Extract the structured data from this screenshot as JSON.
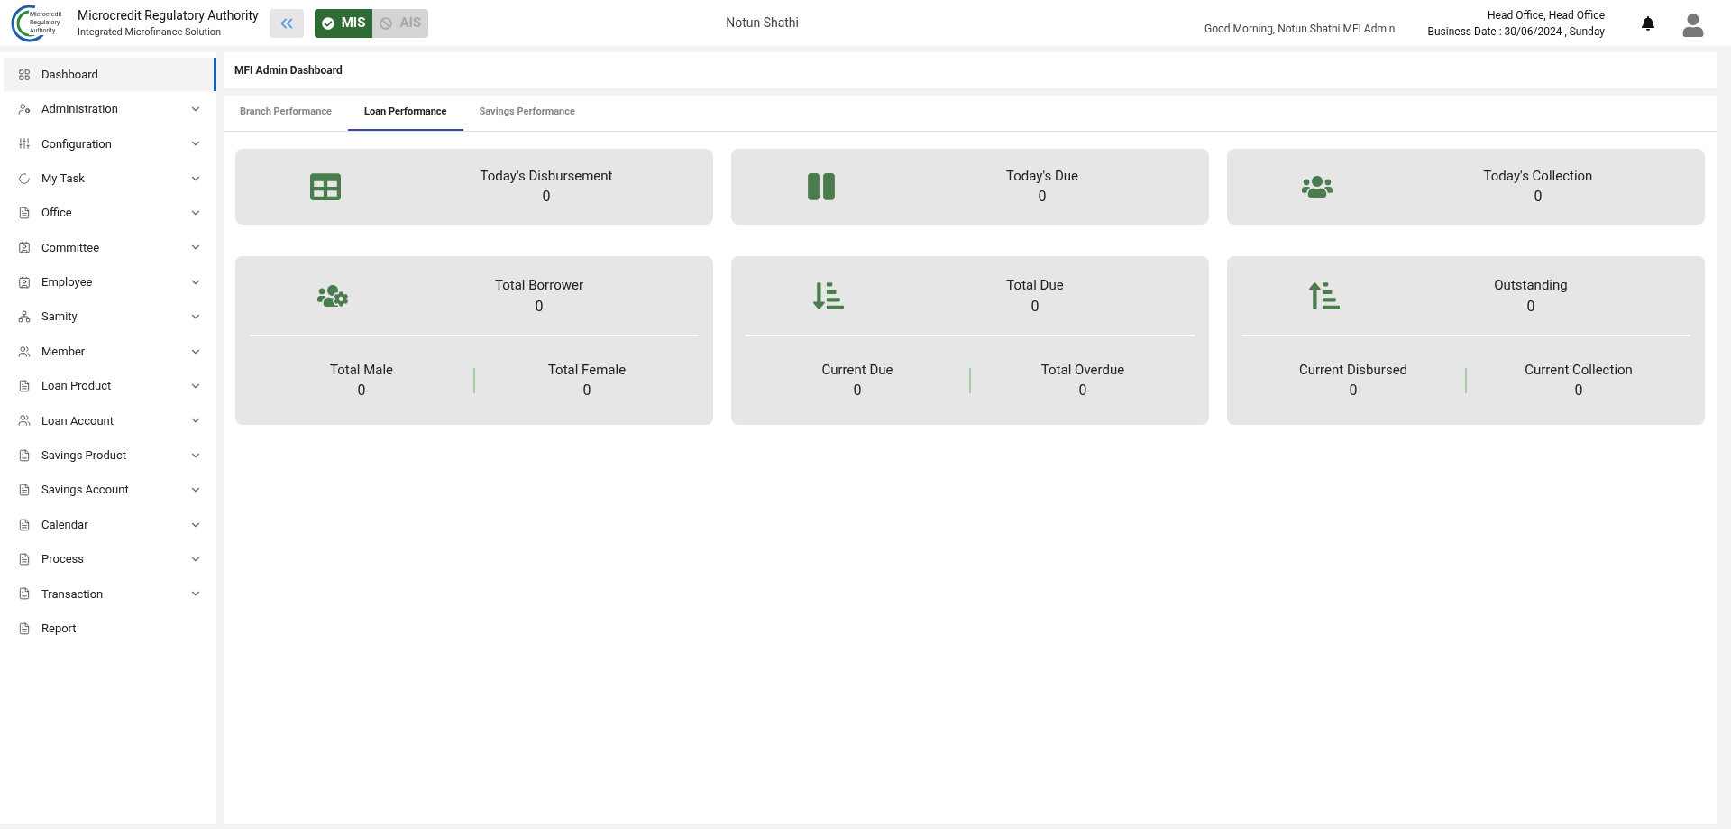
{
  "header": {
    "logo_lines": [
      "Microcredit",
      "Regulatory",
      "Authority"
    ],
    "org_name": "Microcredit Regulatory Authority",
    "org_subtitle": "Integrated Microfinance Solution",
    "modes": [
      {
        "label": "MIS",
        "selected": true
      },
      {
        "label": "AIS",
        "selected": false
      }
    ],
    "center_title": "Notun Shathi",
    "greeting": "Good Morning, Notun Shathi MFI Admin",
    "office": "Head Office, Head Office",
    "business_date": "Business Date : 30/06/2024 , Sunday"
  },
  "sidebar": {
    "items": [
      {
        "label": "Dashboard",
        "kind": "grid",
        "selected": true,
        "expandable": false
      },
      {
        "label": "Administration",
        "kind": "admin",
        "selected": false,
        "expandable": true
      },
      {
        "label": "Configuration",
        "kind": "sliders",
        "selected": false,
        "expandable": true
      },
      {
        "label": "My Task",
        "kind": "task",
        "selected": false,
        "expandable": true
      },
      {
        "label": "Office",
        "kind": "doc",
        "selected": false,
        "expandable": true
      },
      {
        "label": "Committee",
        "kind": "contact",
        "selected": false,
        "expandable": true
      },
      {
        "label": "Employee",
        "kind": "contact",
        "selected": false,
        "expandable": true
      },
      {
        "label": "Samity",
        "kind": "network",
        "selected": false,
        "expandable": true
      },
      {
        "label": "Member",
        "kind": "people",
        "selected": false,
        "expandable": true
      },
      {
        "label": "Loan Product",
        "kind": "doc",
        "selected": false,
        "expandable": true
      },
      {
        "label": "Loan Account",
        "kind": "people",
        "selected": false,
        "expandable": true
      },
      {
        "label": "Savings Product",
        "kind": "doc",
        "selected": false,
        "expandable": true
      },
      {
        "label": "Savings Account",
        "kind": "doc",
        "selected": false,
        "expandable": true
      },
      {
        "label": "Calendar",
        "kind": "doc",
        "selected": false,
        "expandable": true
      },
      {
        "label": "Process",
        "kind": "doc",
        "selected": false,
        "expandable": true
      },
      {
        "label": "Transaction",
        "kind": "doc",
        "selected": false,
        "expandable": true
      },
      {
        "label": "Report",
        "kind": "doc",
        "selected": false,
        "expandable": false
      }
    ]
  },
  "page_title": "MFI Admin Dashboard",
  "tabs": [
    {
      "label": "Branch Performance",
      "selected": false
    },
    {
      "label": "Loan Performance",
      "selected": true
    },
    {
      "label": "Savings Performance",
      "selected": false
    }
  ],
  "summary_cards": [
    {
      "kind": "table",
      "label": "Today's Disbursement",
      "value": "0"
    },
    {
      "kind": "pause",
      "label": "Today's Due",
      "value": "0"
    },
    {
      "kind": "users",
      "label": "Today's Collection",
      "value": "0"
    }
  ],
  "detail_cards": [
    {
      "kind": "users-cog",
      "label": "Total Borrower",
      "value": "0",
      "breakdown": [
        {
          "label": "Total Male",
          "value": "0"
        },
        {
          "label": "Total Female",
          "value": "0"
        }
      ]
    },
    {
      "kind": "sort-down",
      "label": "Total Due",
      "value": "0",
      "breakdown": [
        {
          "label": "Current Due",
          "value": "0"
        },
        {
          "label": "Total Overdue",
          "value": "0"
        }
      ]
    },
    {
      "kind": "sort-up",
      "label": "Outstanding",
      "value": "0",
      "breakdown": [
        {
          "label": "Current Disbursed",
          "value": "0"
        },
        {
          "label": "Current Collection",
          "value": "0"
        }
      ]
    }
  ]
}
